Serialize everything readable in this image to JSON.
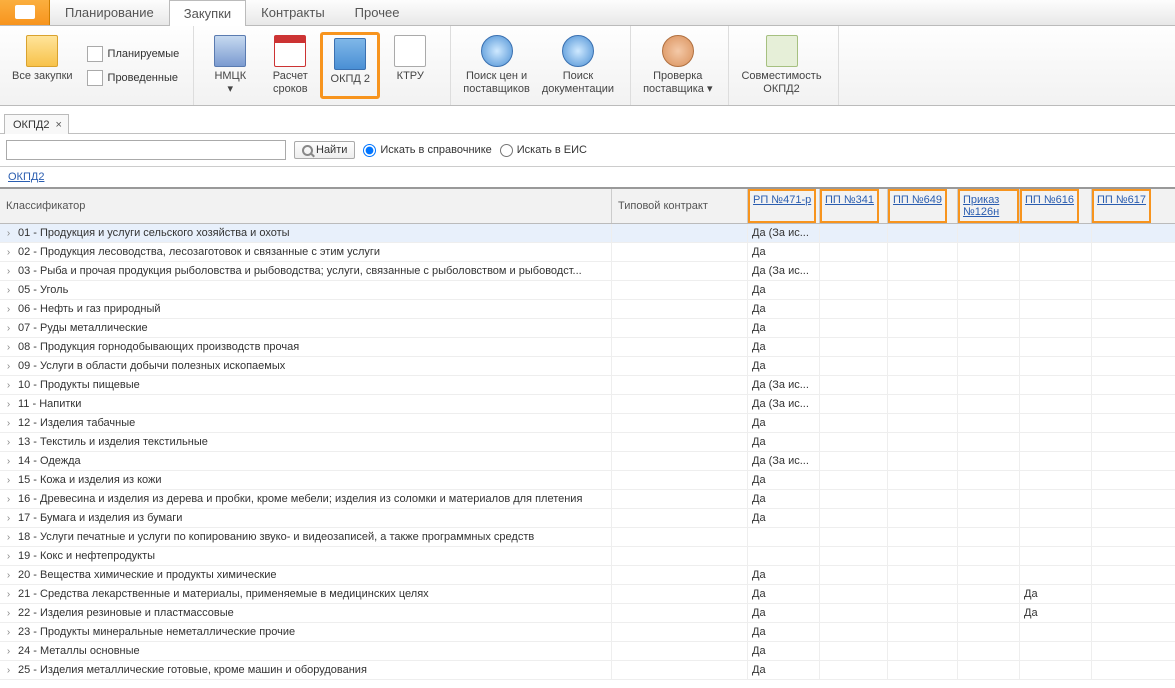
{
  "tabs": {
    "planning": "Планирование",
    "purchases": "Закупки",
    "contracts": "Контракты",
    "other": "Прочее"
  },
  "ribbon": {
    "all_purchases": "Все закупки",
    "planned": "Планируемые",
    "done": "Проведенные",
    "nmck": "НМЦК",
    "calc_terms_l1": "Расчет",
    "calc_terms_l2": "сроков",
    "okpd2": "ОКПД 2",
    "ktru": "КТРУ",
    "price_search_l1": "Поиск цен и",
    "price_search_l2": "поставщиков",
    "doc_search_l1": "Поиск",
    "doc_search_l2": "документации",
    "supplier_check_l1": "Проверка",
    "supplier_check_l2": "поставщика",
    "compat_l1": "Совместимость",
    "compat_l2": "ОКПД2"
  },
  "subtab": {
    "label": "ОКПД2"
  },
  "search": {
    "value": "",
    "find_label": "Найти",
    "radio_directory": "Искать в справочнике",
    "radio_eis": "Искать в ЕИС"
  },
  "breadcrumb": "ОКПД2",
  "columns": {
    "classifier": "Классификатор",
    "typical_contract": "Типовой контракт",
    "rp471": "РП №471-р",
    "pp341": "ПП №341",
    "pp649": "ПП №649",
    "prikaz126": "Приказ №126н",
    "pp616": "ПП №616",
    "pp617": "ПП №617"
  },
  "rows": [
    {
      "name": "01 - Продукция и услуги сельского хозяйства и охоты",
      "rp471": "Да (За ис..."
    },
    {
      "name": "02 - Продукция лесоводства, лесозаготовок и связанные с этим услуги",
      "rp471": "Да"
    },
    {
      "name": "03 - Рыба и прочая продукция рыболовства и рыбоводства; услуги, связанные с рыболовством и рыбоводст...",
      "rp471": "Да (За ис..."
    },
    {
      "name": "05 - Уголь",
      "rp471": "Да"
    },
    {
      "name": "06 - Нефть и газ природный",
      "rp471": "Да"
    },
    {
      "name": "07 - Руды металлические",
      "rp471": "Да"
    },
    {
      "name": "08 - Продукция горнодобывающих производств прочая",
      "rp471": "Да"
    },
    {
      "name": "09 - Услуги в области добычи полезных ископаемых",
      "rp471": "Да"
    },
    {
      "name": "10 - Продукты пищевые",
      "rp471": "Да (За ис..."
    },
    {
      "name": "11 - Напитки",
      "rp471": "Да (За ис..."
    },
    {
      "name": "12 - Изделия табачные",
      "rp471": "Да"
    },
    {
      "name": "13 - Текстиль и изделия текстильные",
      "rp471": "Да"
    },
    {
      "name": "14 - Одежда",
      "rp471": "Да (За ис..."
    },
    {
      "name": "15 - Кожа и изделия из кожи",
      "rp471": "Да"
    },
    {
      "name": "16 - Древесина и изделия из дерева и пробки, кроме мебели; изделия из соломки и материалов для плетения",
      "rp471": "Да"
    },
    {
      "name": "17 - Бумага и изделия из бумаги",
      "rp471": "Да"
    },
    {
      "name": "18 - Услуги печатные и услуги по копированию звуко- и видеозаписей, а также программных средств"
    },
    {
      "name": "19 - Кокс и нефтепродукты"
    },
    {
      "name": "20 - Вещества химические и продукты химические",
      "rp471": "Да"
    },
    {
      "name": "21 - Средства лекарственные и материалы, применяемые в медицинских целях",
      "rp471": "Да",
      "pp616": "Да"
    },
    {
      "name": "22 - Изделия резиновые и пластмассовые",
      "rp471": "Да",
      "pp616": "Да"
    },
    {
      "name": "23 - Продукты минеральные неметаллические прочие",
      "rp471": "Да"
    },
    {
      "name": "24 - Металлы основные",
      "rp471": "Да"
    },
    {
      "name": "25 - Изделия металлические готовые, кроме машин и оборудования",
      "rp471": "Да"
    }
  ]
}
